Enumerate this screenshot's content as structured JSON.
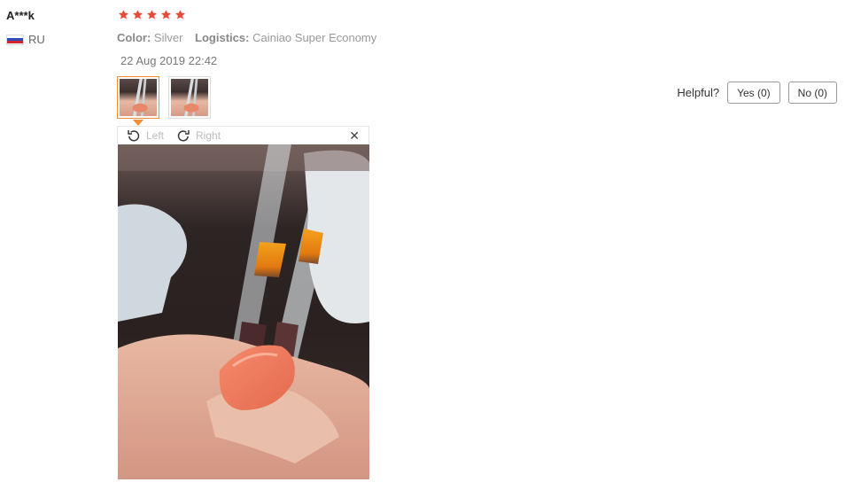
{
  "review": {
    "user": {
      "name": "A***k",
      "country_code": "RU"
    },
    "rating": {
      "stars": 5,
      "max": 5,
      "color": "#e84c3d"
    },
    "attributes": {
      "color_key": "Color:",
      "color_value": "Silver",
      "logistics_key": "Logistics:",
      "logistics_value": "Cainiao Super Economy"
    },
    "date": "22 Aug 2019 22:42",
    "thumbnails": [
      {
        "icon": "photo-thumbnail",
        "active": true
      },
      {
        "icon": "photo-thumbnail",
        "active": false
      }
    ],
    "helpful": {
      "label": "Helpful?",
      "yes_label": "Yes (0)",
      "no_label": "No (0)"
    },
    "viewer": {
      "rotate_left_label": "Left",
      "rotate_right_label": "Right",
      "close_icon": "close-icon",
      "accent_color": "#f08c3a"
    }
  }
}
